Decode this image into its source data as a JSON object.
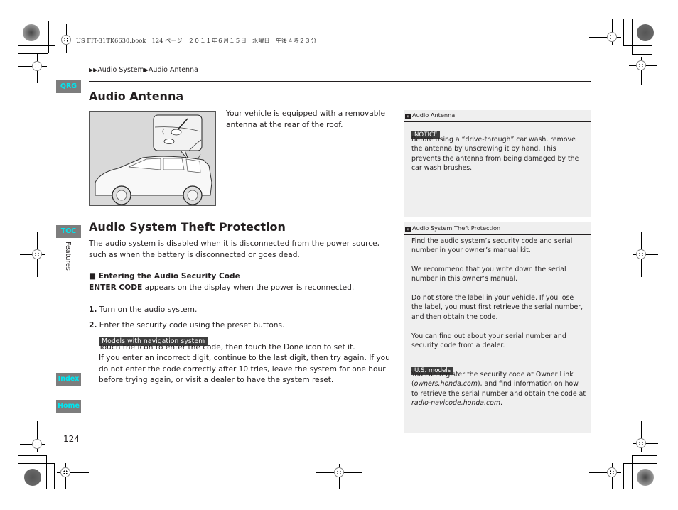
{
  "print_header": "US FIT-31TK6630.book　124 ページ　２０１１年６月１５日　水曜日　午後４時２３分",
  "breadcrumb": {
    "items": [
      "Audio System",
      "Audio Antenna"
    ]
  },
  "nav_tabs": {
    "qrg": "QRG",
    "toc": "TOC",
    "index": "Index",
    "home": "Home",
    "chapter_label": "Features",
    "accent_color": "#00e6f0",
    "tab_bg_color": "#7d7d7d"
  },
  "page_number": "124",
  "section_antenna": {
    "title": "Audio Antenna",
    "illustration_alt": "Car side view with antenna detail callout",
    "body": "Your vehicle is equipped with a removable antenna at the rear of the roof."
  },
  "section_theft": {
    "title": "Audio System Theft Protection",
    "intro": "The audio system is disabled when it is disconnected from the power source, such as when the battery is disconnected or goes dead.",
    "subheading": "Entering the Audio Security Code",
    "enter_code_bold": "ENTER CODE",
    "enter_code_rest": " appears on the display when the power is reconnected.",
    "steps": [
      {
        "num": "1.",
        "text": "Turn on the audio system."
      },
      {
        "num": "2.",
        "text": "Enter the security code using the preset buttons."
      }
    ],
    "nav_tag": "Models with navigation system",
    "nav_text": "Touch the icon to enter the code, then touch the Done icon to set it.",
    "retry_text": "If you enter an incorrect digit, continue to the last digit, then try again. If you do not enter the code correctly after 10 tries, leave the system for one hour before trying again, or visit a dealer to have the system reset."
  },
  "sidebar_antenna": {
    "title": "Audio Antenna",
    "notice_label": "NOTICE",
    "notice_text": "Before using a “drive-through” car wash, remove the antenna by unscrewing it by hand. This prevents the antenna from being damaged by the car wash brushes."
  },
  "sidebar_theft": {
    "title": "Audio System Theft Protection",
    "paragraphs": [
      "Find the audio system’s security code and serial number in your owner’s manual kit.",
      "We recommend that you write down the serial number in this owner’s manual.",
      "Do not store the label in your vehicle. If you lose the label, you must first retrieve the serial number, and then obtain the code.",
      "You can find out about your serial number and security code from a dealer."
    ],
    "us_tag": "U.S. models",
    "us_text_1": "You can register the security code at Owner Link (",
    "us_link_1": "owners.honda.com",
    "us_text_2": "), and find information on how to retrieve the serial number and obtain the code at ",
    "us_link_2": "radio-navicode.honda.com",
    "us_text_3": "."
  }
}
